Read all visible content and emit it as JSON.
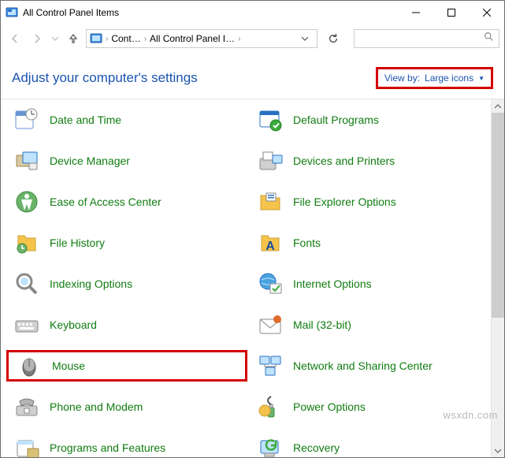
{
  "window": {
    "title": "All Control Panel Items"
  },
  "address": {
    "crumb1": "Cont…",
    "crumb2": "All Control Panel I…"
  },
  "header": {
    "heading": "Adjust your computer's settings",
    "viewby_label": "View by:",
    "viewby_value": "Large icons"
  },
  "items": {
    "left": [
      {
        "label": "Date and Time",
        "icon": "datetime"
      },
      {
        "label": "Device Manager",
        "icon": "device-manager"
      },
      {
        "label": "Ease of Access Center",
        "icon": "ease-access"
      },
      {
        "label": "File History",
        "icon": "file-history"
      },
      {
        "label": "Indexing Options",
        "icon": "indexing"
      },
      {
        "label": "Keyboard",
        "icon": "keyboard"
      },
      {
        "label": "Mouse",
        "icon": "mouse",
        "highlight": true
      },
      {
        "label": "Phone and Modem",
        "icon": "phone-modem"
      },
      {
        "label": "Programs and Features",
        "icon": "programs"
      }
    ],
    "right": [
      {
        "label": "Default Programs",
        "icon": "default-programs"
      },
      {
        "label": "Devices and Printers",
        "icon": "devices-printers"
      },
      {
        "label": "File Explorer Options",
        "icon": "file-explorer"
      },
      {
        "label": "Fonts",
        "icon": "fonts"
      },
      {
        "label": "Internet Options",
        "icon": "internet"
      },
      {
        "label": "Mail (32-bit)",
        "icon": "mail"
      },
      {
        "label": "Network and Sharing Center",
        "icon": "network"
      },
      {
        "label": "Power Options",
        "icon": "power"
      },
      {
        "label": "Recovery",
        "icon": "recovery"
      }
    ]
  },
  "watermark": "wsxdn.com"
}
